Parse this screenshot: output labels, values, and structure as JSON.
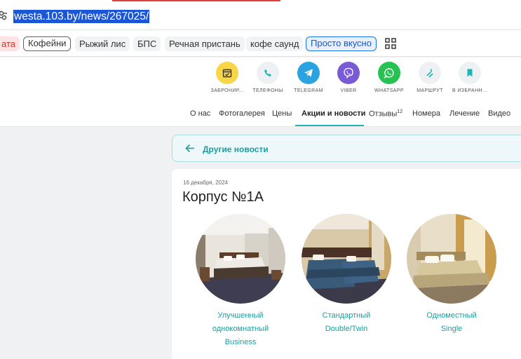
{
  "browser": {
    "url": "westa.103.by/news/267025/",
    "bookmarks": [
      "ата",
      "Кофейни",
      "Рыжий лис",
      "БПС",
      "Речная пристань",
      "кофе саунд",
      "Просто вкусно"
    ]
  },
  "header": {
    "actions": [
      {
        "label": "ЗАБРОНИР...",
        "icon": "calendar-icon",
        "color": "#f9d648"
      },
      {
        "label": "ТЕЛЕФОНЫ",
        "icon": "phone-icon",
        "color": "#eef1f4"
      },
      {
        "label": "TELEGRAM",
        "icon": "telegram-icon",
        "color": "#2aa3e0"
      },
      {
        "label": "VIBER",
        "icon": "viber-icon",
        "color": "#7a5bd6"
      },
      {
        "label": "WHATSAPP",
        "icon": "whatsapp-icon",
        "color": "#27c252"
      },
      {
        "label": "МАРШРУТ",
        "icon": "route-icon",
        "color": "#eef1f4"
      },
      {
        "label": "В ИЗБРАНН...",
        "icon": "bookmark-icon",
        "color": "#eef1f4"
      }
    ],
    "nav": {
      "items": [
        "О нас",
        "Фотогалерея",
        "Цены",
        "Акции и новости",
        "Отзывы",
        "Номера",
        "Лечение",
        "Видео"
      ],
      "reviews_count": "12"
    }
  },
  "content": {
    "back_label": "Другие новости",
    "date": "16 декабря, 2024",
    "title": "Корпус №1А",
    "rooms": [
      {
        "line1": "Улучшенный",
        "line2": "однокомнатный",
        "line3": "Business"
      },
      {
        "line1": "Стандартный",
        "line2": "Double/Twin",
        "line3": ""
      },
      {
        "line1": "Одноместный",
        "line2": "Single",
        "line3": ""
      }
    ]
  },
  "colors": {
    "accent": "#1fb5b5",
    "link": "#1a9e9e",
    "url_highlight": "#1a56d6"
  }
}
